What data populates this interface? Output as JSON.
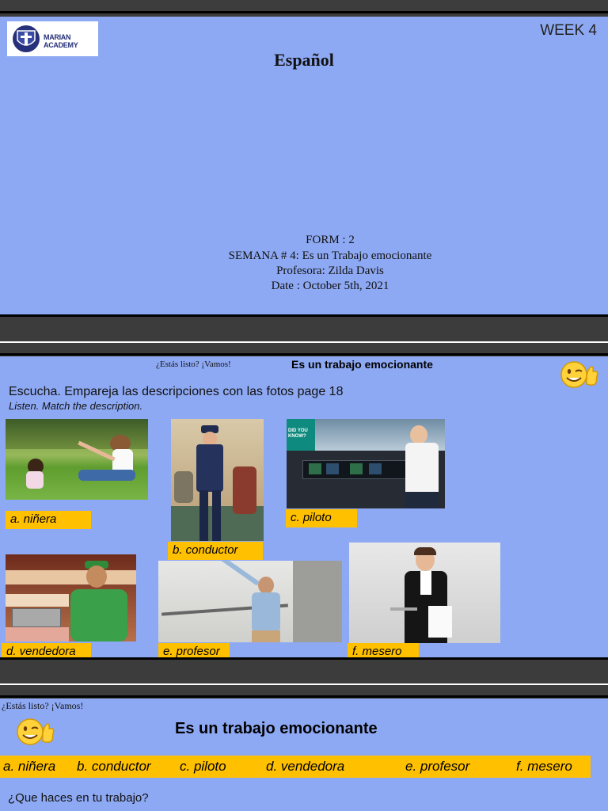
{
  "slide1": {
    "logo_text": "MARIAN ACADEMY",
    "week": "WEEK 4",
    "title": "Español",
    "form": "FORM : 2",
    "semana": "SEMANA # 4: Es un Trabajo emocionante",
    "profesora": "Profesora: Zilda Davis",
    "date": "Date :  October 5th, 2021"
  },
  "slide2": {
    "ready": "¿Estás listo? ¡Vamos!",
    "heading": "Es un trabajo emocionante",
    "instruction_es": "Escucha. Empareja las descripciones con las fotos page 18",
    "instruction_en": "Listen. Match the  description.",
    "labels": {
      "a": "a. niñera",
      "b": "b. conductor",
      "c": "c. piloto",
      "d": "d. vendedora",
      "e": "e. profesor",
      "f": "f. mesero"
    },
    "cockpit_badge": "DID YOU KNOW?"
  },
  "slide3": {
    "ready": "¿Estás listo? ¡Vamos!",
    "heading": "Es un trabajo emocionante",
    "bar_items": [
      "a. niñera",
      "b. conductor",
      "c. piloto",
      "d. vendedora",
      "e. profesor",
      "f. mesero"
    ],
    "question": "¿Que haces en tu trabajo?"
  }
}
